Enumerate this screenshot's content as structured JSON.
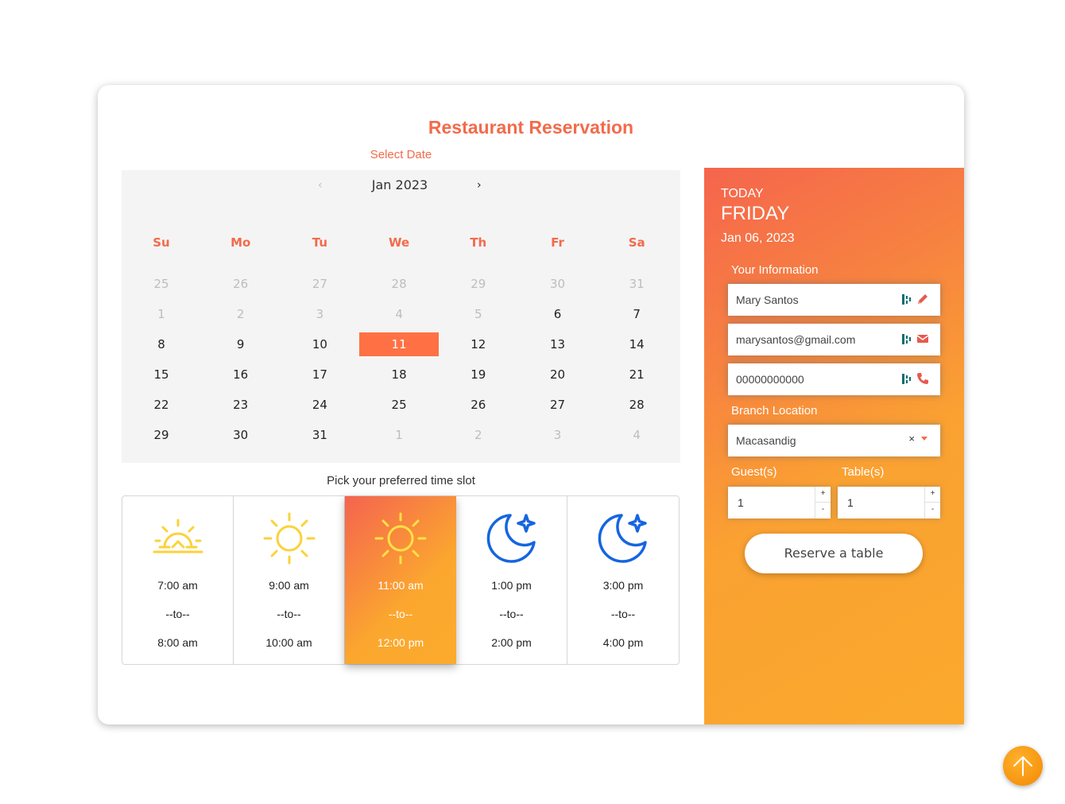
{
  "title": "Restaurant Reservation",
  "select_date_label": "Select Date",
  "calendar": {
    "month_label": "Jan 2023",
    "prev": "‹",
    "next": "›",
    "weekdays": [
      "Su",
      "Mo",
      "Tu",
      "We",
      "Th",
      "Fr",
      "Sa"
    ],
    "weeks": [
      [
        "25",
        "26",
        "27",
        "28",
        "29",
        "30",
        "31"
      ],
      [
        "1",
        "2",
        "3",
        "4",
        "5",
        "6",
        "7"
      ],
      [
        "8",
        "9",
        "10",
        "11",
        "12",
        "13",
        "14"
      ],
      [
        "15",
        "16",
        "17",
        "18",
        "19",
        "20",
        "21"
      ],
      [
        "22",
        "23",
        "24",
        "25",
        "26",
        "27",
        "28"
      ],
      [
        "29",
        "30",
        "31",
        "1",
        "2",
        "3",
        "4"
      ]
    ],
    "selected_day": "11",
    "accent_color": "#ff7144"
  },
  "time_slot_label": "Pick your preferred time slot",
  "time_slots": [
    {
      "icon": "sunrise-icon",
      "start": "7:00 am",
      "sep": "--to--",
      "end": "8:00 am",
      "selected": false
    },
    {
      "icon": "sun-icon",
      "start": "9:00 am",
      "sep": "--to--",
      "end": "10:00 am",
      "selected": false
    },
    {
      "icon": "sun-icon",
      "start": "11:00 am",
      "sep": "--to--",
      "end": "12:00 pm",
      "selected": true
    },
    {
      "icon": "moon-star-icon",
      "start": "1:00 pm",
      "sep": "--to--",
      "end": "2:00 pm",
      "selected": false
    },
    {
      "icon": "moon-star-icon",
      "start": "3:00 pm",
      "sep": "--to--",
      "end": "4:00 pm",
      "selected": false
    }
  ],
  "sidebar": {
    "today_label": "TODAY",
    "weekday": "FRIDAY",
    "date": "Jan 06, 2023",
    "info_label": "Your Information",
    "name": "Mary Santos",
    "email": "marysantos@gmail.com",
    "phone": "00000000000",
    "branch_label": "Branch Location",
    "branch_value": "Macasandig",
    "clear_symbol": "×",
    "guests_label": "Guest(s)",
    "guests_value": "1",
    "tables_label": "Table(s)",
    "tables_value": "1",
    "spin_up": "+",
    "spin_down": "-",
    "reserve_label": "Reserve a table"
  },
  "colors": {
    "brand": "#f26b4b",
    "gradient_start": "#f5634f",
    "gradient_end": "#fba92d",
    "night_icon": "#1565e0",
    "day_icon": "#fbd23a"
  }
}
